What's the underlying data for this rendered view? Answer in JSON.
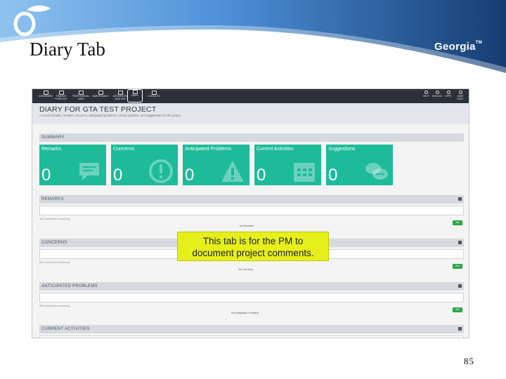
{
  "slide": {
    "title": "Diary Tab",
    "page_number": "85",
    "logo_text": "Georgia",
    "logo_tm": "TM",
    "colors": {
      "header_dark": "#1e4a86",
      "header_light": "#5a9be0"
    }
  },
  "app": {
    "nav_items": [
      {
        "label": "DASHBOARD",
        "icon": "dashboard-icon"
      },
      {
        "label": "FINANCE FORECAST",
        "icon": "finance-icon"
      },
      {
        "label": "PROFESSIONAL CARD",
        "icon": "card-icon"
      },
      {
        "label": "MAINTENANCE",
        "icon": "maintenance-icon"
      },
      {
        "label": "ANTICIPATED ANALYSIS",
        "icon": "analysis-icon"
      },
      {
        "label": "DIARY",
        "icon": "diary-icon",
        "active": true
      },
      {
        "label": "CONTACTS",
        "icon": "contacts-icon"
      }
    ],
    "nav_right": [
      {
        "label": "HELP",
        "icon": "help-icon"
      },
      {
        "label": "ENGLISH",
        "icon": "language-icon"
      },
      {
        "label": "APPS",
        "icon": "apps-icon"
      },
      {
        "label": "DANE DOLE",
        "icon": "user-icon"
      }
    ],
    "page_title": "DIARY FOR GTA TEST PROJECT",
    "page_subtitle": "A record of tasks, remarks, concerns, anticipated problems, current activities, and suggestions for the project.",
    "summary_label": "SUMMARY",
    "cards": [
      {
        "title": "Remarks",
        "count": "0",
        "icon": "chat-bubble-icon"
      },
      {
        "title": "Concerns",
        "count": "0",
        "icon": "exclamation-circle-icon"
      },
      {
        "title": "Anticipated Problems",
        "count": "0",
        "icon": "warning-triangle-icon"
      },
      {
        "title": "Current Activities",
        "count": "0",
        "icon": "calendar-icon"
      },
      {
        "title": "Suggestions",
        "count": "0",
        "icon": "speech-bubbles-icon"
      }
    ],
    "card_color": "#1dbb9a",
    "sections": [
      {
        "label": "REMARKS",
        "chars": "500 characters remaining",
        "empty": "No Remarks",
        "add": "Add"
      },
      {
        "label": "CONCERNS",
        "chars": "500 characters remaining",
        "empty": "No Concerns",
        "add": "Add"
      },
      {
        "label": "ANTICIPATED PROBLEMS",
        "chars": "500 characters remaining",
        "empty": "No Anticipated Problems",
        "add": "Add"
      },
      {
        "label": "CURRENT ACTIVITIES"
      }
    ]
  },
  "callout": {
    "line1": "This tab is for the PM to",
    "line2": "document project comments."
  }
}
